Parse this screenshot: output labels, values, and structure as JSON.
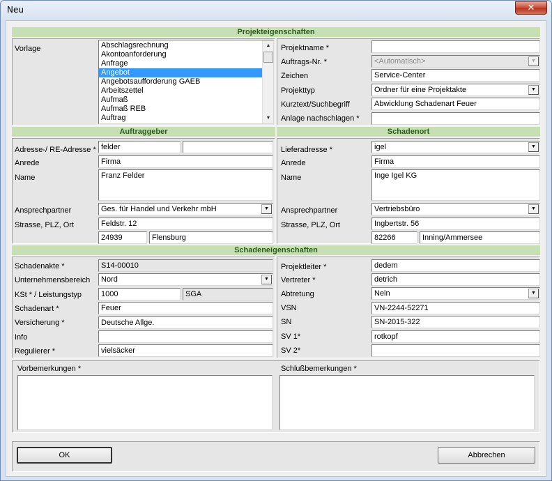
{
  "window": {
    "title": "Neu",
    "close_label": "✕"
  },
  "sections": {
    "projekt": "Projekteigenschaften",
    "auftraggeber": "Auftraggeber",
    "schadenort": "Schadenort",
    "schaden": "Schadeneigenschaften"
  },
  "vorlage": {
    "label": "Vorlage",
    "items": [
      "Abschlagsrechnung",
      "Akontoanforderung",
      "Anfrage",
      "Angebot",
      "Angebotsaufforderung GAEB",
      "Arbeitszettel",
      "Aufmaß",
      "Aufmaß REB",
      "Auftrag"
    ],
    "selected_index": 3
  },
  "projekt": {
    "projektname_label": "Projektname *",
    "projektname_value": "",
    "auftragsnr_label": "Auftrags-Nr. *",
    "auftragsnr_value": "<Automatisch>",
    "zeichen_label": "Zeichen",
    "zeichen_value": "Service-Center",
    "projekttyp_label": "Projekttyp",
    "projekttyp_value": "Ordner für eine Projektakte",
    "kurztext_label": "Kurztext/Suchbegriff",
    "kurztext_value": "Abwicklung Schadenart Feuer",
    "anlage_label": "Anlage nachschlagen *",
    "anlage_value": ""
  },
  "auftraggeber": {
    "adresse_label": "Adresse-/ RE-Adresse *",
    "adresse_value": "felder",
    "adresse_value2": "",
    "anrede_label": "Anrede",
    "anrede_value": "Firma",
    "name_label": "Name",
    "name_value": "Franz Felder",
    "ansprech_label": "Ansprechpartner",
    "ansprech_value": "Ges. für Handel und Verkehr mbH",
    "strasse_label": "Strasse, PLZ, Ort",
    "strasse_value": "Feldstr. 12",
    "plz_value": "24939",
    "ort_value": "Flensburg"
  },
  "schadenort": {
    "liefer_label": "Lieferadresse *",
    "liefer_value": "igel",
    "anrede_label": "Anrede",
    "anrede_value": "Firma",
    "name_label": "Name",
    "name_value": "Inge Igel KG",
    "ansprech_label": "Ansprechpartner",
    "ansprech_value": "Vertriebsbüro",
    "strasse_label": "Strasse, PLZ, Ort",
    "strasse_value": "Ingbertstr. 56",
    "plz_value": "82266",
    "ort_value": "Inning/Ammersee"
  },
  "schaden": {
    "akte_label": "Schadenakte *",
    "akte_value": "S14-00010",
    "bereich_label": "Unternehmensbereich",
    "bereich_value": "Nord",
    "kst_label": "KSt * / Leistungstyp",
    "kst_value": "1000",
    "lt_value": "SGA",
    "art_label": "Schadenart *",
    "art_value": "Feuer",
    "vers_label": "Versicherung *",
    "vers_value": "Deutsche Allge.",
    "info_label": "Info",
    "info_value": "",
    "reg_label": "Regulierer *",
    "reg_value": "vielsäcker",
    "pl_label": "Projektleiter *",
    "pl_value": "dedem",
    "vertreter_label": "Vertreter *",
    "vertreter_value": "detrich",
    "abtretung_label": "Abtretung",
    "abtretung_value": "Nein",
    "vsn_label": "VSN",
    "vsn_value": "VN-2244-52271",
    "sn_label": "SN",
    "sn_value": "SN-2015-322",
    "sv1_label": "SV 1*",
    "sv1_value": "rotkopf",
    "sv2_label": "SV 2*",
    "sv2_value": ""
  },
  "bemerkungen": {
    "vor_label": "Vorbemerkungen *",
    "schluss_label": "Schlußbemerkungen *"
  },
  "buttons": {
    "ok": "OK",
    "abbrechen": "Abbrechen"
  }
}
